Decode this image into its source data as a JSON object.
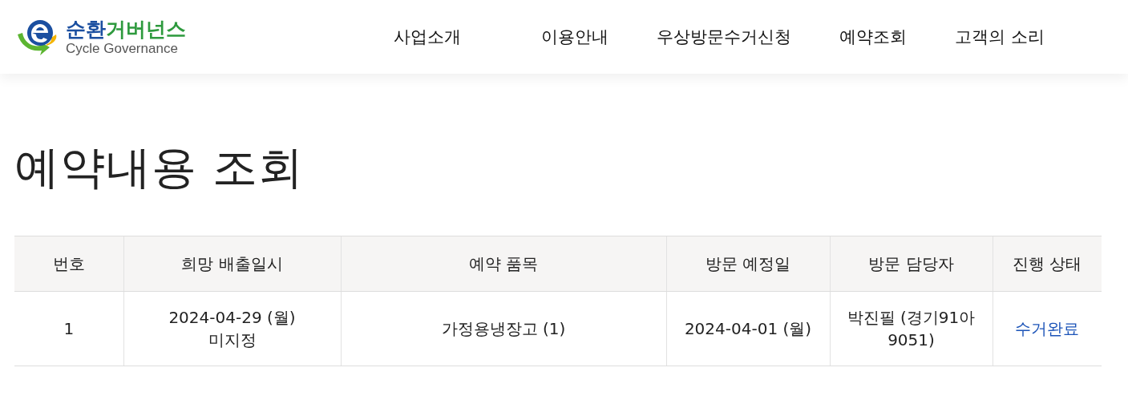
{
  "logo": {
    "name_blue": "순환",
    "name_green": "거버넌스",
    "subtitle": "Cycle Governance"
  },
  "nav": [
    {
      "label": "사업소개"
    },
    {
      "label": "이용안내"
    },
    {
      "label": "우상방문수거신청"
    },
    {
      "label": "예약조회"
    },
    {
      "label": "고객의 소리"
    }
  ],
  "page_title": "예약내용 조회",
  "table": {
    "columns": [
      "번호",
      "희망 배출일시",
      "예약 품목",
      "방문 예정일",
      "방문 담당자",
      "진행 상태"
    ],
    "rows": [
      {
        "number": "1",
        "desired_date": [
          "2024-04-29 (월)",
          "미지정"
        ],
        "item": "가정용냉장고 (1)",
        "visit_date": "2024-04-01 (월)",
        "staff": "박진필 (경기91아 9051)",
        "status": {
          "label": "수거완료",
          "kind": "link"
        }
      }
    ]
  }
}
